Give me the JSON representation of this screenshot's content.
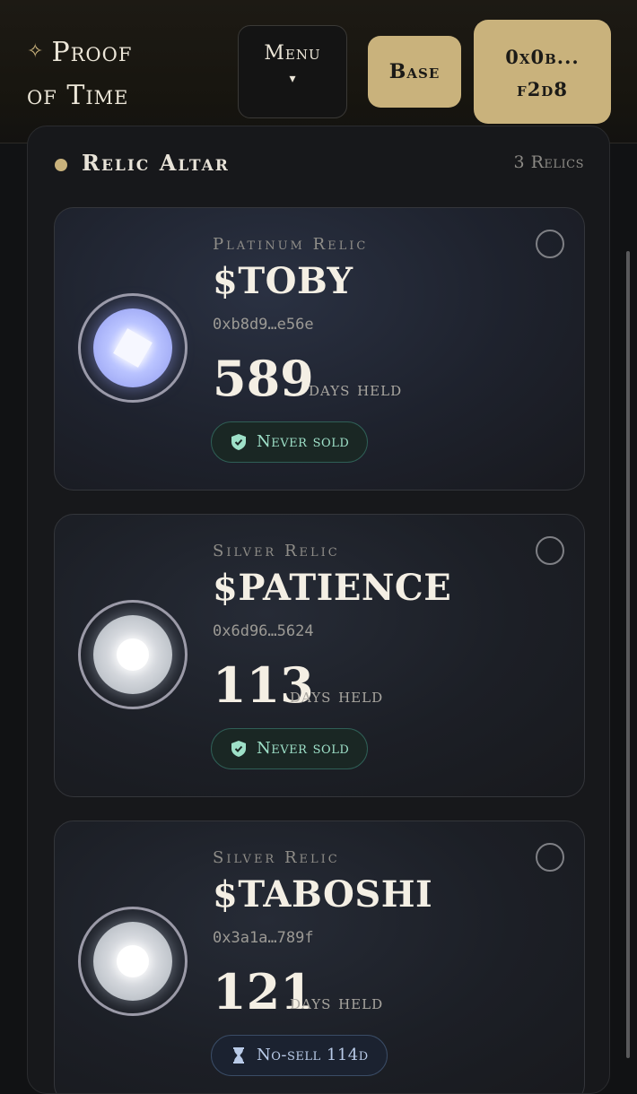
{
  "header": {
    "brand_star": "✧",
    "brand_line1": "Proof",
    "brand_line2": "of Time",
    "menu_label": "Menu",
    "menu_caret": "▾",
    "network_label": "Base",
    "wallet_line1": "0x0b...",
    "wallet_line2": "f2d8"
  },
  "panel": {
    "title": "Relic Altar",
    "count": "3 Relics"
  },
  "relics": [
    {
      "tier": "Platinum Relic",
      "ticker": "$TOBY",
      "address": "0xb8d9…e56e",
      "days": "589",
      "days_label": "days held",
      "status": "Never sold",
      "status_icon": "shield-check-icon"
    },
    {
      "tier": "Silver Relic",
      "ticker": "$PATIENCE",
      "address": "0x6d96…5624",
      "days": "113",
      "days_label": "days held",
      "status": "Never sold",
      "status_icon": "shield-check-icon"
    },
    {
      "tier": "Silver Relic",
      "ticker": "$TABOSHI",
      "address": "0x3a1a…789f",
      "days": "121",
      "days_label": "days held",
      "status": "No-sell 114d",
      "status_icon": "hourglass-icon"
    }
  ],
  "colors": {
    "accent_gold": "#c9b27c",
    "status_green": "#9ee0c8",
    "status_blue": "#b9cbe8",
    "platinum_glow": "#b9c3ff"
  }
}
